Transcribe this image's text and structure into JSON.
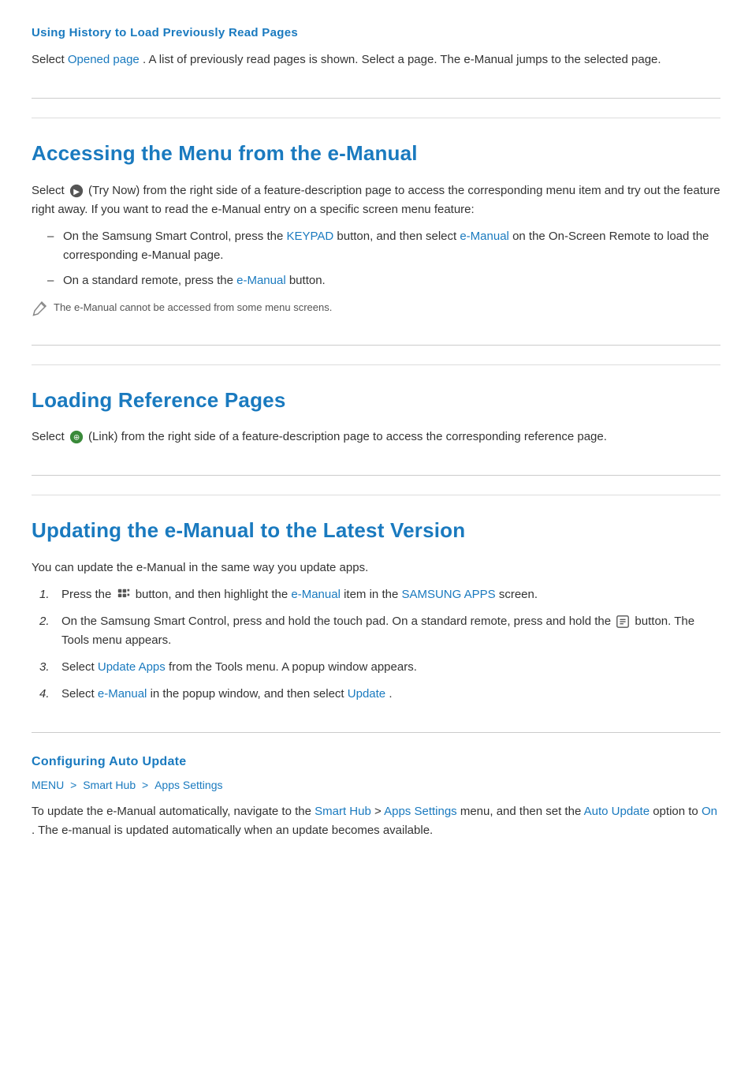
{
  "page": {
    "sections": [
      {
        "id": "history-section",
        "title": "Using History to Load Previously Read Pages",
        "title_size": "small",
        "paragraph": "Select Opened page. A list of previously read pages is shown. Select a page. The e-Manual jumps to the selected page.",
        "highlight_words": [
          "Opened page"
        ]
      },
      {
        "id": "accessing-menu-section",
        "title": "Accessing the Menu from the e-Manual",
        "title_size": "large",
        "intro": "Select  (Try Now) from the right side of a feature-description page to access the corresponding menu item and try out the feature right away. If you want to read the e-Manual entry on a specific screen menu feature:",
        "bullets": [
          "On the Samsung Smart Control, press the KEYPAD button, and then select e-Manual on the On-Screen Remote to load the corresponding e-Manual page.",
          "On a standard remote, press the e-Manual button."
        ],
        "highlight_words_bullets": [
          [
            "KEYPAD",
            "e-Manual"
          ],
          [
            "e-Manual"
          ]
        ],
        "note": "The e-Manual cannot be accessed from some menu screens."
      },
      {
        "id": "loading-reference-section",
        "title": "Loading Reference Pages",
        "title_size": "large",
        "paragraph": "Select  (Link) from the right side of a feature-description page to access the corresponding reference page."
      },
      {
        "id": "updating-section",
        "title": "Updating the e-Manual to the Latest Version",
        "title_size": "large",
        "intro": "You can update the e-Manual in the same way you update apps.",
        "steps": [
          "Press the  button, and then highlight the e-Manual item in the SAMSUNG APPS screen.",
          "On the Samsung Smart Control, press and hold the touch pad. On a standard remote, press and hold the  button. The Tools menu appears.",
          "Select Update Apps from the Tools menu. A popup window appears.",
          "Select e-Manual in the popup window, and then select Update."
        ],
        "highlight_words_steps": [
          [
            "e-Manual",
            "SAMSUNG APPS"
          ],
          [],
          [
            "Update Apps"
          ],
          [
            "e-Manual",
            "Update"
          ]
        ]
      },
      {
        "id": "auto-update-section",
        "title": "Configuring Auto Update",
        "title_size": "small",
        "breadcrumb": {
          "items": [
            "MENU",
            "Smart Hub",
            "Apps Settings"
          ]
        },
        "paragraph": "To update the e-Manual automatically, navigate to the Smart Hub > Apps Settings menu, and then set the Auto Update option to On. The e-manual is updated automatically when an update becomes available.",
        "highlight_words": [
          "Smart Hub",
          "Apps Settings",
          "Auto Update",
          "On"
        ]
      }
    ]
  },
  "colors": {
    "accent": "#1a7abf",
    "text": "#333333",
    "note_text": "#555555"
  },
  "labels": {
    "history_title": "Using History to Load Previously Read Pages",
    "history_para": "Select ",
    "opened_page": "Opened page",
    "history_para_rest": ". A list of previously read pages is shown. Select a page. The e-Manual jumps to the selected page.",
    "accessing_title": "Accessing the Menu from the e-Manual",
    "accessing_intro": "Select",
    "accessing_intro_rest": "(Try Now) from the right side of a feature-description page to access the corresponding menu item and try out the feature right away. If you want to read the e-Manual entry on a specific screen menu feature:",
    "bullet1_pre": "On the Samsung Smart Control, press the ",
    "bullet1_keypad": "KEYPAD",
    "bullet1_mid": " button, and then select ",
    "bullet1_emanual": "e-Manual",
    "bullet1_post": " on the On-Screen Remote to load the corresponding e-Manual page.",
    "bullet2_pre": "On a standard remote, press the ",
    "bullet2_emanual": "e-Manual",
    "bullet2_post": " button.",
    "note": "The e-Manual cannot be accessed from some menu screens.",
    "loading_title": "Loading Reference Pages",
    "loading_para_pre": "Select",
    "loading_para_post": "(Link) from the right side of a feature-description page to access the corresponding reference page.",
    "updating_title": "Updating the e-Manual to the Latest Version",
    "updating_intro": "You can update the e-Manual in the same way you update apps.",
    "step1_pre": "Press the",
    "step1_mid": "button, and then highlight the ",
    "step1_emanual": "e-Manual",
    "step1_post": " item in the ",
    "step1_apps": "SAMSUNG APPS",
    "step1_end": " screen.",
    "step2": "On the Samsung Smart Control, press and hold the touch pad. On a standard remote, press and hold the",
    "step2_mid": "button. The Tools menu appears.",
    "step3_pre": "Select ",
    "step3_update": "Update Apps",
    "step3_post": " from the Tools menu. A popup window appears.",
    "step4_pre": "Select ",
    "step4_emanual": "e-Manual",
    "step4_mid": " in the popup window, and then select ",
    "step4_update": "Update",
    "step4_end": ".",
    "auto_update_title": "Configuring Auto Update",
    "breadcrumb_menu": "MENU",
    "breadcrumb_smarthub": "Smart Hub",
    "breadcrumb_apps": "Apps Settings",
    "auto_para_pre": "To update the e-Manual automatically, navigate to the ",
    "auto_smarthub": "Smart Hub",
    "auto_sep": " > ",
    "auto_apps": "Apps Settings",
    "auto_mid": " menu, and then set the ",
    "auto_update": "Auto Update",
    "auto_option": " option to ",
    "auto_on": "On",
    "auto_end": ". The e-manual is updated automatically when an update becomes available."
  }
}
